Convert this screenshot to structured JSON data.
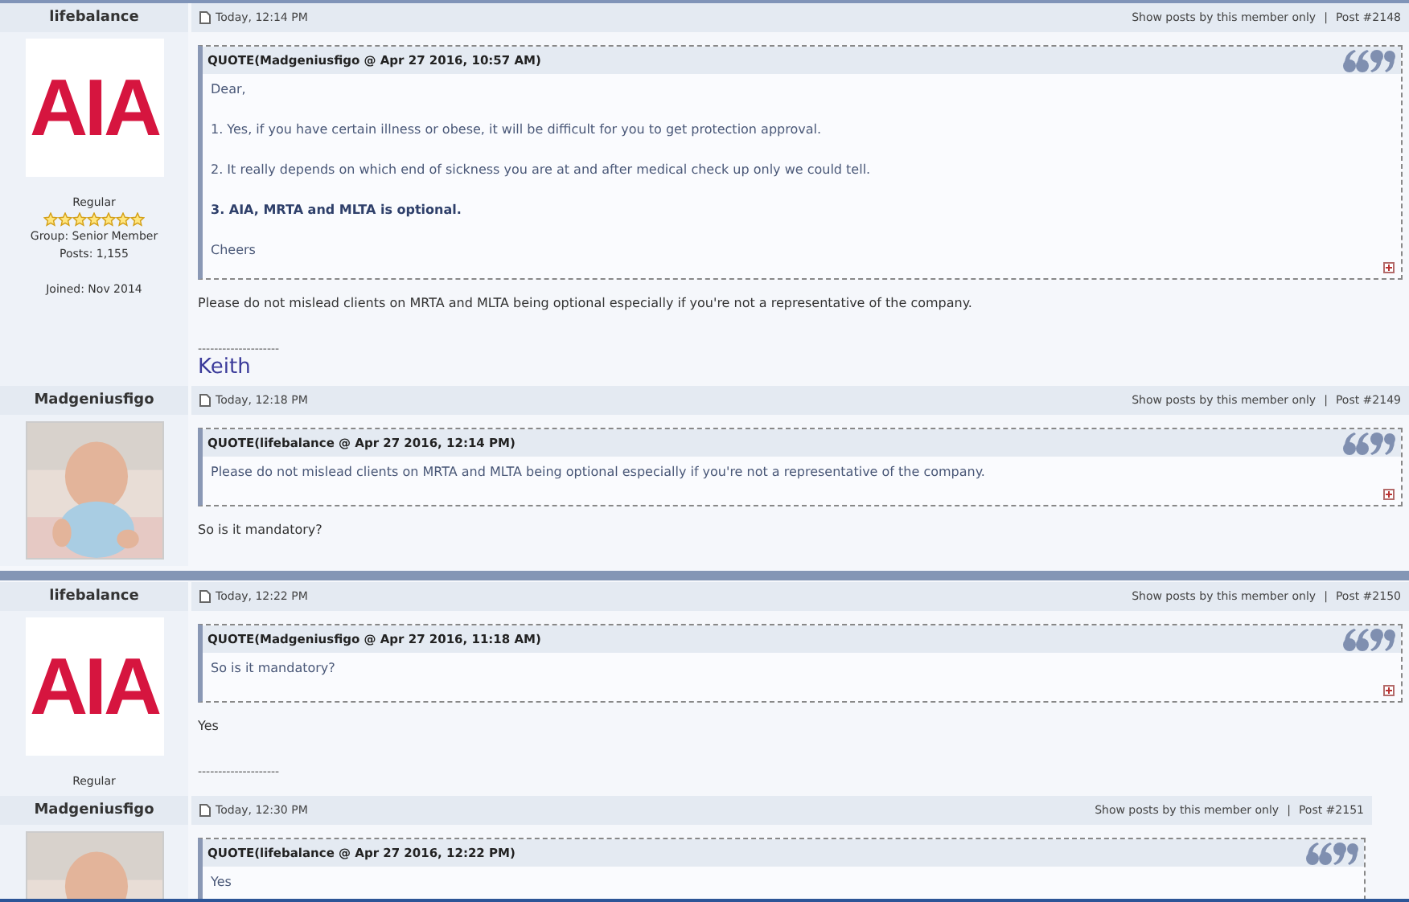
{
  "posts": [
    {
      "author": "lifebalance",
      "time": "Today, 12:14 PM",
      "links": [
        "Show posts by this member only",
        "Post #2148"
      ],
      "separator": "|",
      "avatar": {
        "kind": "logo",
        "text": "AIA"
      },
      "member": {
        "rank": "Regular",
        "stars": 7,
        "group": "Group: Senior Member",
        "posts": "Posts: 1,155",
        "joined": "Joined: Nov 2014"
      },
      "quote": {
        "header": "QUOTE(Madgeniusfigo @ Apr 27 2016, 10:57 AM)",
        "lines": [
          {
            "text": "Dear,",
            "bold": false
          },
          {
            "text": "1. Yes, if you have certain illness or obese, it will be difficult for you to get protection approval.",
            "bold": false
          },
          {
            "text": "2. It really depends on which end of sickness you are at and after medical check up only we could tell.",
            "bold": false
          },
          {
            "text": "3. AIA, MRTA and MLTA is optional.",
            "bold": true
          },
          {
            "text": "Cheers",
            "bold": false
          }
        ]
      },
      "body": "Please do not mislead clients on MRTA and MLTA being optional especially if you're not a representative of the company.",
      "signature": {
        "rule": "--------------------",
        "name": "Keith"
      }
    },
    {
      "author": "Madgeniusfigo",
      "time": "Today, 12:18 PM",
      "links": [
        "Show posts by this member only",
        "Post #2149"
      ],
      "separator": "|",
      "quote": {
        "header": "QUOTE(lifebalance @ Apr 27 2016, 12:14 PM)",
        "lines": [
          {
            "text": "Please do not mislead clients on MRTA and MLTA being optional especially if you're not a representative of the company.",
            "bold": false
          }
        ]
      },
      "body": "So is it mandatory?"
    },
    {
      "author": "lifebalance",
      "time": "Today, 12:22 PM",
      "links": [
        "Show posts by this member only",
        "Post #2150"
      ],
      "separator": "|",
      "avatar": {
        "kind": "logo",
        "text": "AIA"
      },
      "member": {
        "rank": "Regular"
      },
      "quote": {
        "header": "QUOTE(Madgeniusfigo @ Apr 27 2016, 11:18 AM)",
        "lines": [
          {
            "text": "So is it mandatory?",
            "bold": false
          }
        ]
      },
      "body": "Yes",
      "signature": {
        "rule": "--------------------"
      }
    },
    {
      "author": "Madgeniusfigo",
      "time": "Today, 12:30 PM",
      "links": [
        "Show posts by this member only",
        "Post #2151"
      ],
      "separator": "|",
      "quote": {
        "header": "QUOTE(lifebalance @ Apr 27 2016, 12:22 PM)",
        "lines": [
          {
            "text": "Yes",
            "bold": false
          }
        ]
      }
    }
  ]
}
